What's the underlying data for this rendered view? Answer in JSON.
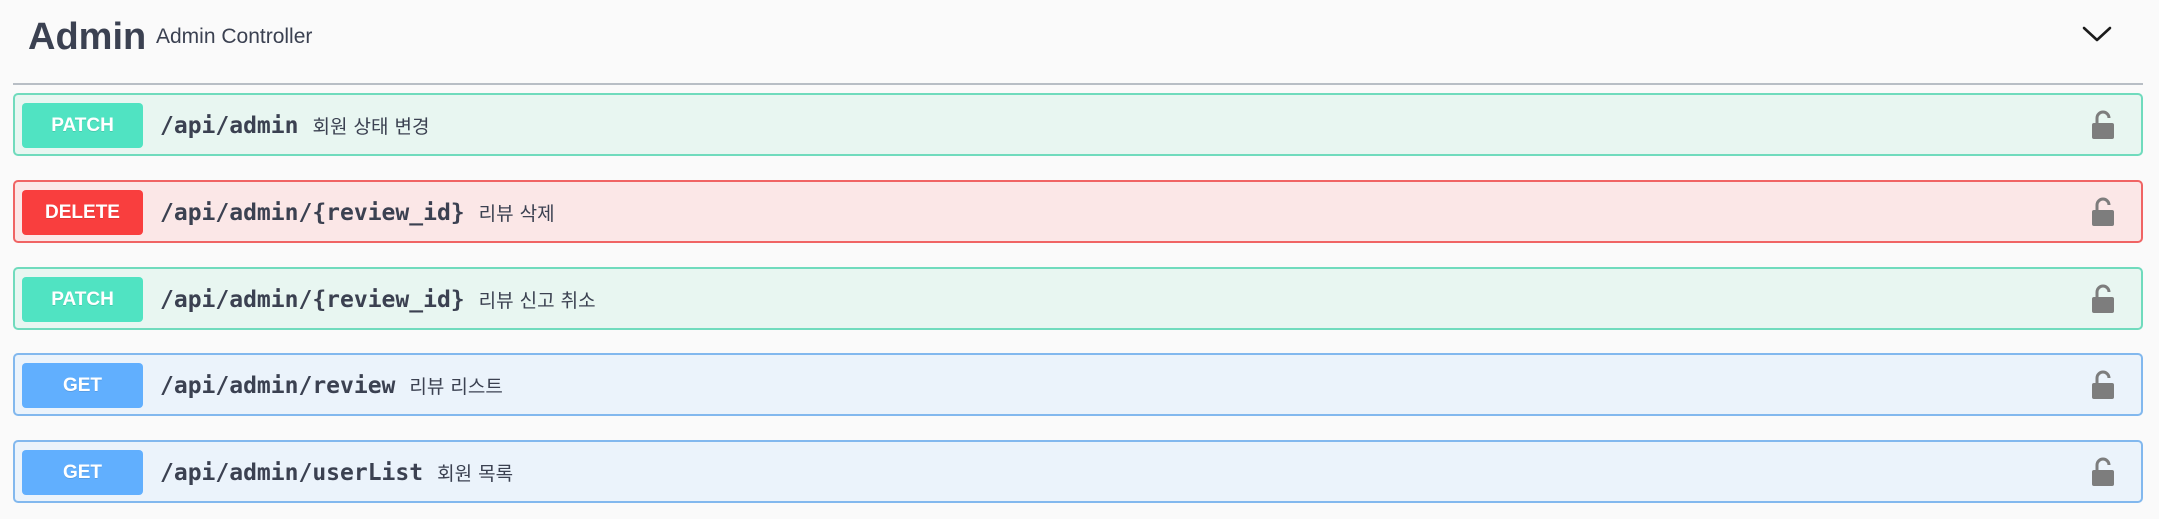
{
  "tag": {
    "name": "Admin",
    "description": "Admin Controller",
    "toggle_icon": "chevron-down-icon"
  },
  "operations": [
    {
      "method": "PATCH",
      "path": "/api/admin",
      "summary": "회원 상태 변경",
      "lock_icon": "lock-icon"
    },
    {
      "method": "DELETE",
      "path": "/api/admin/{review_id}",
      "summary": "리뷰 삭제",
      "lock_icon": "lock-icon"
    },
    {
      "method": "PATCH",
      "path": "/api/admin/{review_id}",
      "summary": "리뷰 신고 취소",
      "lock_icon": "lock-icon"
    },
    {
      "method": "GET",
      "path": "/api/admin/review",
      "summary": "리뷰 리스트",
      "lock_icon": "lock-icon"
    },
    {
      "method": "GET",
      "path": "/api/admin/userList",
      "summary": "회원 목록",
      "lock_icon": "lock-icon"
    }
  ],
  "colors": {
    "patch": "#50e3c2",
    "delete": "#f93e3e",
    "get": "#61affe",
    "text": "#3b4151"
  }
}
